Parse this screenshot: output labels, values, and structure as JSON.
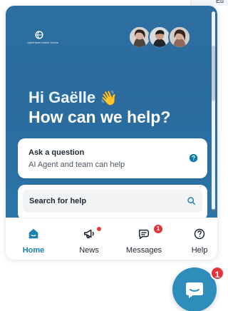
{
  "host": {
    "corner_text": "Eu"
  },
  "messenger": {
    "logo_text": "CyberHaven Hacker Service",
    "greeting": "Hi Gaëlle",
    "headline": "How can we help?",
    "cards": {
      "ask": {
        "title": "Ask a question",
        "subtitle": "AI Agent and team can help"
      },
      "search": {
        "label": "Search for help"
      }
    },
    "nav": [
      {
        "label": "Home"
      },
      {
        "label": "News"
      },
      {
        "label": "Messages",
        "badge": "1"
      },
      {
        "label": "Help"
      }
    ]
  },
  "launcher": {
    "badge": "1"
  },
  "icons": {
    "brand": "logo-icon",
    "wave": "waving-hand-icon",
    "help": "question-icon",
    "search": "search-icon",
    "home": "home-icon",
    "news": "megaphone-icon",
    "messages": "message-icon",
    "help_nav": "help-icon",
    "launcher": "chat-icon"
  },
  "colors": {
    "hero": "#2d6fa0",
    "accent": "#1b82b0",
    "badge": "#e2353b",
    "launcher": "#2e8dbb"
  }
}
